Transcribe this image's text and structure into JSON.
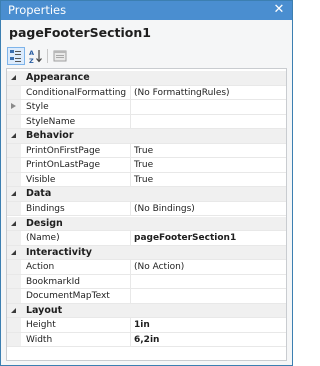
{
  "window": {
    "title": "Properties",
    "close_glyph": "✕"
  },
  "object_name": "pageFooterSection1",
  "toolbar": {
    "buttons": [
      "categorized-icon",
      "alphabetical-icon",
      "property-pages-icon"
    ]
  },
  "categories": [
    {
      "name": "Appearance",
      "props": [
        {
          "name": "ConditionalFormatting",
          "value": "(No FormattingRules)"
        },
        {
          "name": "Style",
          "value": "",
          "expandable": true
        },
        {
          "name": "StyleName",
          "value": ""
        }
      ]
    },
    {
      "name": "Behavior",
      "props": [
        {
          "name": "PrintOnFirstPage",
          "value": "True"
        },
        {
          "name": "PrintOnLastPage",
          "value": "True"
        },
        {
          "name": "Visible",
          "value": "True"
        }
      ]
    },
    {
      "name": "Data",
      "props": [
        {
          "name": "Bindings",
          "value": "(No Bindings)"
        }
      ]
    },
    {
      "name": "Design",
      "props": [
        {
          "name": "(Name)",
          "value": "pageFooterSection1",
          "bold": true
        }
      ]
    },
    {
      "name": "Interactivity",
      "props": [
        {
          "name": "Action",
          "value": "(No Action)"
        },
        {
          "name": "BookmarkId",
          "value": ""
        },
        {
          "name": "DocumentMapText",
          "value": ""
        }
      ]
    },
    {
      "name": "Layout",
      "props": [
        {
          "name": "Height",
          "value": "1in",
          "bold": true
        },
        {
          "name": "Width",
          "value": "6,2in",
          "bold": true
        }
      ]
    }
  ]
}
